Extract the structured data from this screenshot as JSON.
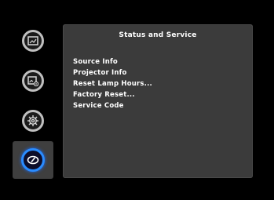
{
  "panel": {
    "title": "Status and Service",
    "items": [
      {
        "label": "Source Info"
      },
      {
        "label": "Projector Info"
      },
      {
        "label": "Reset Lamp Hours..."
      },
      {
        "label": "Factory Reset..."
      },
      {
        "label": "Service Code"
      }
    ]
  },
  "sidebar": {
    "items": [
      {
        "icon": "picture-icon",
        "active": false
      },
      {
        "icon": "picture-settings-icon",
        "active": false
      },
      {
        "icon": "gear-icon",
        "active": false
      },
      {
        "icon": "status-gauge-icon",
        "active": true
      }
    ]
  },
  "colors": {
    "background": "#000000",
    "panel": "#3b3b3b",
    "active_ring": "#2a8cff",
    "inactive_ring": "#bfbfbf",
    "text": "#ffffff"
  }
}
